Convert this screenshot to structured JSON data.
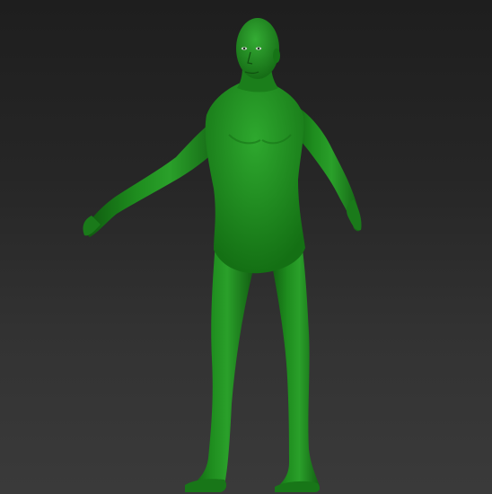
{
  "viewport": {
    "background_top": "#1e1e1e",
    "background_bottom": "#3a3a3a"
  },
  "model": {
    "subject": "human-figure-a-pose",
    "material_color": "#1f8a1f",
    "highlight_color": "#3fbf3f",
    "shadow_color": "#0d4a0d"
  }
}
